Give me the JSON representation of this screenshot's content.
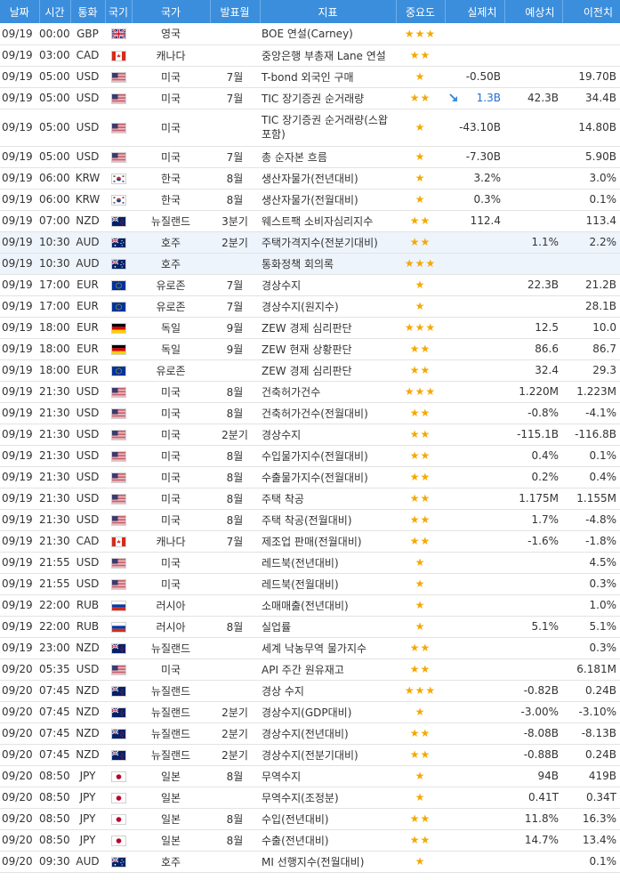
{
  "header": {
    "date": "날짜",
    "time": "시간",
    "currency": "통화",
    "flag": "국기",
    "country": "국가",
    "period": "발표월",
    "indicator": "지표",
    "importance": "중요도",
    "actual": "실제치",
    "forecast": "예상치",
    "previous": "이전치"
  },
  "colors": {
    "header_bg": "#3B8EDC",
    "star": "#F5A800",
    "actual_up": "#1E6FD0",
    "highlight_row": "#EEF4FB"
  },
  "rows": [
    {
      "date": "09/19",
      "time": "00:00",
      "currency": "GBP",
      "flag": "gb-flag",
      "country": "영국",
      "period": "",
      "indicator": "BOE 연설(Carney)",
      "stars": "★★★",
      "actual": "",
      "forecast": "",
      "previous": ""
    },
    {
      "date": "09/19",
      "time": "03:00",
      "currency": "CAD",
      "flag": "ca-flag",
      "country": "캐나다",
      "period": "",
      "indicator": "중앙은행 부총재 Lane 연설",
      "stars": "★★",
      "actual": "",
      "forecast": "",
      "previous": ""
    },
    {
      "date": "09/19",
      "time": "05:00",
      "currency": "USD",
      "flag": "us-flag",
      "country": "미국",
      "period": "7월",
      "indicator": "T-bond 외국인 구매",
      "stars": "★",
      "actual": "-0.50B",
      "forecast": "",
      "previous": "19.70B"
    },
    {
      "date": "09/19",
      "time": "05:00",
      "currency": "USD",
      "flag": "us-flag",
      "country": "미국",
      "period": "7월",
      "indicator": "TIC 장기증권 순거래량",
      "stars": "★★",
      "actual": "1.3B",
      "forecast": "42.3B",
      "previous": "34.4B",
      "actual_arrow": "down-arrow-icon"
    },
    {
      "date": "09/19",
      "time": "05:00",
      "currency": "USD",
      "flag": "us-flag",
      "country": "미국",
      "period": "",
      "indicator": "TIC 장기증권 순거래량(스왑 포함)",
      "stars": "★",
      "actual": "-43.10B",
      "forecast": "",
      "previous": "14.80B"
    },
    {
      "date": "09/19",
      "time": "05:00",
      "currency": "USD",
      "flag": "us-flag",
      "country": "미국",
      "period": "7월",
      "indicator": "총 순자본 흐름",
      "stars": "★",
      "actual": "-7.30B",
      "forecast": "",
      "previous": "5.90B"
    },
    {
      "date": "09/19",
      "time": "06:00",
      "currency": "KRW",
      "flag": "kr-flag",
      "country": "한국",
      "period": "8월",
      "indicator": "생산자물가(전년대비)",
      "stars": "★",
      "actual": "3.2%",
      "forecast": "",
      "previous": "3.0%"
    },
    {
      "date": "09/19",
      "time": "06:00",
      "currency": "KRW",
      "flag": "kr-flag",
      "country": "한국",
      "period": "8월",
      "indicator": "생산자물가(전월대비)",
      "stars": "★",
      "actual": "0.3%",
      "forecast": "",
      "previous": "0.1%"
    },
    {
      "date": "09/19",
      "time": "07:00",
      "currency": "NZD",
      "flag": "nz-flag",
      "country": "뉴질랜드",
      "period": "3분기",
      "indicator": "웨스트팩 소비자심리지수",
      "stars": "★★",
      "actual": "112.4",
      "forecast": "",
      "previous": "113.4"
    },
    {
      "date": "09/19",
      "time": "10:30",
      "currency": "AUD",
      "flag": "au-flag",
      "country": "호주",
      "period": "2분기",
      "indicator": "주택가격지수(전분기대비)",
      "stars": "★★",
      "actual": "",
      "forecast": "1.1%",
      "previous": "2.2%"
    },
    {
      "date": "09/19",
      "time": "10:30",
      "currency": "AUD",
      "flag": "au-flag",
      "country": "호주",
      "period": "",
      "indicator": "통화정책 회의록",
      "stars": "★★★",
      "actual": "",
      "forecast": "",
      "previous": ""
    },
    {
      "date": "09/19",
      "time": "17:00",
      "currency": "EUR",
      "flag": "eu-flag",
      "country": "유로존",
      "period": "7월",
      "indicator": "경상수지",
      "stars": "★",
      "actual": "",
      "forecast": "22.3B",
      "previous": "21.2B"
    },
    {
      "date": "09/19",
      "time": "17:00",
      "currency": "EUR",
      "flag": "eu-flag",
      "country": "유로존",
      "period": "7월",
      "indicator": "경상수지(원지수)",
      "stars": "★",
      "actual": "",
      "forecast": "",
      "previous": "28.1B"
    },
    {
      "date": "09/19",
      "time": "18:00",
      "currency": "EUR",
      "flag": "de-flag",
      "country": "독일",
      "period": "9월",
      "indicator": "ZEW 경제 심리판단",
      "stars": "★★★",
      "actual": "",
      "forecast": "12.5",
      "previous": "10.0"
    },
    {
      "date": "09/19",
      "time": "18:00",
      "currency": "EUR",
      "flag": "de-flag",
      "country": "독일",
      "period": "9월",
      "indicator": "ZEW 현재 상황판단",
      "stars": "★★",
      "actual": "",
      "forecast": "86.6",
      "previous": "86.7"
    },
    {
      "date": "09/19",
      "time": "18:00",
      "currency": "EUR",
      "flag": "eu-flag",
      "country": "유로존",
      "period": "",
      "indicator": "ZEW 경제 심리판단",
      "stars": "★★",
      "actual": "",
      "forecast": "32.4",
      "previous": "29.3"
    },
    {
      "date": "09/19",
      "time": "21:30",
      "currency": "USD",
      "flag": "us-flag",
      "country": "미국",
      "period": "8월",
      "indicator": "건축허가건수",
      "stars": "★★★",
      "actual": "",
      "forecast": "1.220M",
      "previous": "1.223M"
    },
    {
      "date": "09/19",
      "time": "21:30",
      "currency": "USD",
      "flag": "us-flag",
      "country": "미국",
      "period": "8월",
      "indicator": "건축허가건수(전월대비)",
      "stars": "★★",
      "actual": "",
      "forecast": "-0.8%",
      "previous": "-4.1%"
    },
    {
      "date": "09/19",
      "time": "21:30",
      "currency": "USD",
      "flag": "us-flag",
      "country": "미국",
      "period": "2분기",
      "indicator": "경상수지",
      "stars": "★★",
      "actual": "",
      "forecast": "-115.1B",
      "previous": "-116.8B"
    },
    {
      "date": "09/19",
      "time": "21:30",
      "currency": "USD",
      "flag": "us-flag",
      "country": "미국",
      "period": "8월",
      "indicator": "수입물가지수(전월대비)",
      "stars": "★★",
      "actual": "",
      "forecast": "0.4%",
      "previous": "0.1%"
    },
    {
      "date": "09/19",
      "time": "21:30",
      "currency": "USD",
      "flag": "us-flag",
      "country": "미국",
      "period": "8월",
      "indicator": "수출물가지수(전월대비)",
      "stars": "★★",
      "actual": "",
      "forecast": "0.2%",
      "previous": "0.4%"
    },
    {
      "date": "09/19",
      "time": "21:30",
      "currency": "USD",
      "flag": "us-flag",
      "country": "미국",
      "period": "8월",
      "indicator": "주택 착공",
      "stars": "★★",
      "actual": "",
      "forecast": "1.175M",
      "previous": "1.155M"
    },
    {
      "date": "09/19",
      "time": "21:30",
      "currency": "USD",
      "flag": "us-flag",
      "country": "미국",
      "period": "8월",
      "indicator": "주택 착공(전월대비)",
      "stars": "★★",
      "actual": "",
      "forecast": "1.7%",
      "previous": "-4.8%"
    },
    {
      "date": "09/19",
      "time": "21:30",
      "currency": "CAD",
      "flag": "ca-flag",
      "country": "캐나다",
      "period": "7월",
      "indicator": "제조업 판매(전월대비)",
      "stars": "★★",
      "actual": "",
      "forecast": "-1.6%",
      "previous": "-1.8%"
    },
    {
      "date": "09/19",
      "time": "21:55",
      "currency": "USD",
      "flag": "us-flag",
      "country": "미국",
      "period": "",
      "indicator": "레드북(전년대비)",
      "stars": "★",
      "actual": "",
      "forecast": "",
      "previous": "4.5%"
    },
    {
      "date": "09/19",
      "time": "21:55",
      "currency": "USD",
      "flag": "us-flag",
      "country": "미국",
      "period": "",
      "indicator": "레드북(전월대비)",
      "stars": "★",
      "actual": "",
      "forecast": "",
      "previous": "0.3%"
    },
    {
      "date": "09/19",
      "time": "22:00",
      "currency": "RUB",
      "flag": "ru-flag",
      "country": "러시아",
      "period": "",
      "indicator": "소매매출(전년대비)",
      "stars": "★",
      "actual": "",
      "forecast": "",
      "previous": "1.0%"
    },
    {
      "date": "09/19",
      "time": "22:00",
      "currency": "RUB",
      "flag": "ru-flag",
      "country": "러시아",
      "period": "8월",
      "indicator": "실업률",
      "stars": "★",
      "actual": "",
      "forecast": "5.1%",
      "previous": "5.1%"
    },
    {
      "date": "09/19",
      "time": "23:00",
      "currency": "NZD",
      "flag": "nz-flag",
      "country": "뉴질랜드",
      "period": "",
      "indicator": "세계 낙농무역 물가지수",
      "stars": "★★",
      "actual": "",
      "forecast": "",
      "previous": "0.3%"
    },
    {
      "date": "09/20",
      "time": "05:35",
      "currency": "USD",
      "flag": "us-flag",
      "country": "미국",
      "period": "",
      "indicator": "API 주간 원유재고",
      "stars": "★★",
      "actual": "",
      "forecast": "",
      "previous": "6.181M"
    },
    {
      "date": "09/20",
      "time": "07:45",
      "currency": "NZD",
      "flag": "nz-flag",
      "country": "뉴질랜드",
      "period": "",
      "indicator": "경상 수지",
      "stars": "★★★",
      "actual": "",
      "forecast": "-0.82B",
      "previous": "0.24B"
    },
    {
      "date": "09/20",
      "time": "07:45",
      "currency": "NZD",
      "flag": "nz-flag",
      "country": "뉴질랜드",
      "period": "2분기",
      "indicator": "경상수지(GDP대비)",
      "stars": "★",
      "actual": "",
      "forecast": "-3.00%",
      "previous": "-3.10%"
    },
    {
      "date": "09/20",
      "time": "07:45",
      "currency": "NZD",
      "flag": "nz-flag",
      "country": "뉴질랜드",
      "period": "2분기",
      "indicator": "경상수지(전년대비)",
      "stars": "★★",
      "actual": "",
      "forecast": "-8.08B",
      "previous": "-8.13B"
    },
    {
      "date": "09/20",
      "time": "07:45",
      "currency": "NZD",
      "flag": "nz-flag",
      "country": "뉴질랜드",
      "period": "2분기",
      "indicator": "경상수지(전분기대비)",
      "stars": "★★",
      "actual": "",
      "forecast": "-0.88B",
      "previous": "0.24B"
    },
    {
      "date": "09/20",
      "time": "08:50",
      "currency": "JPY",
      "flag": "jp-flag",
      "country": "일본",
      "period": "8월",
      "indicator": "무역수지",
      "stars": "★",
      "actual": "",
      "forecast": "94B",
      "previous": "419B"
    },
    {
      "date": "09/20",
      "time": "08:50",
      "currency": "JPY",
      "flag": "jp-flag",
      "country": "일본",
      "period": "",
      "indicator": "무역수지(조정분)",
      "stars": "★",
      "actual": "",
      "forecast": "0.41T",
      "previous": "0.34T"
    },
    {
      "date": "09/20",
      "time": "08:50",
      "currency": "JPY",
      "flag": "jp-flag",
      "country": "일본",
      "period": "8월",
      "indicator": "수입(전년대비)",
      "stars": "★★",
      "actual": "",
      "forecast": "11.8%",
      "previous": "16.3%"
    },
    {
      "date": "09/20",
      "time": "08:50",
      "currency": "JPY",
      "flag": "jp-flag",
      "country": "일본",
      "period": "8월",
      "indicator": "수출(전년대비)",
      "stars": "★★",
      "actual": "",
      "forecast": "14.7%",
      "previous": "13.4%"
    },
    {
      "date": "09/20",
      "time": "09:30",
      "currency": "AUD",
      "flag": "au-flag",
      "country": "호주",
      "period": "",
      "indicator": "MI 선행지수(전월대비)",
      "stars": "★",
      "actual": "",
      "forecast": "",
      "previous": "0.1%"
    }
  ]
}
